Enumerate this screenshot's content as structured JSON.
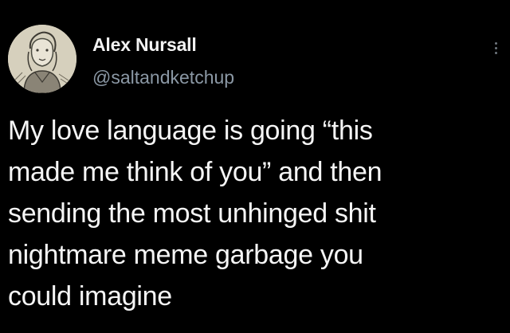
{
  "tweet": {
    "author": {
      "display_name": "Alex Nursall",
      "handle": "@saltandketchup",
      "avatar_icon": "sketch-portrait-avatar"
    },
    "more_icon": "more-options-icon",
    "text": "My love language is going “this\nmade me think of you” and then\nsending the most unhinged shit\nnightmare meme garbage you\ncould imagine"
  },
  "colors": {
    "background": "#000000",
    "name": "#f2f2f2",
    "handle": "#8b98a5",
    "text": "#f5f5f5"
  }
}
